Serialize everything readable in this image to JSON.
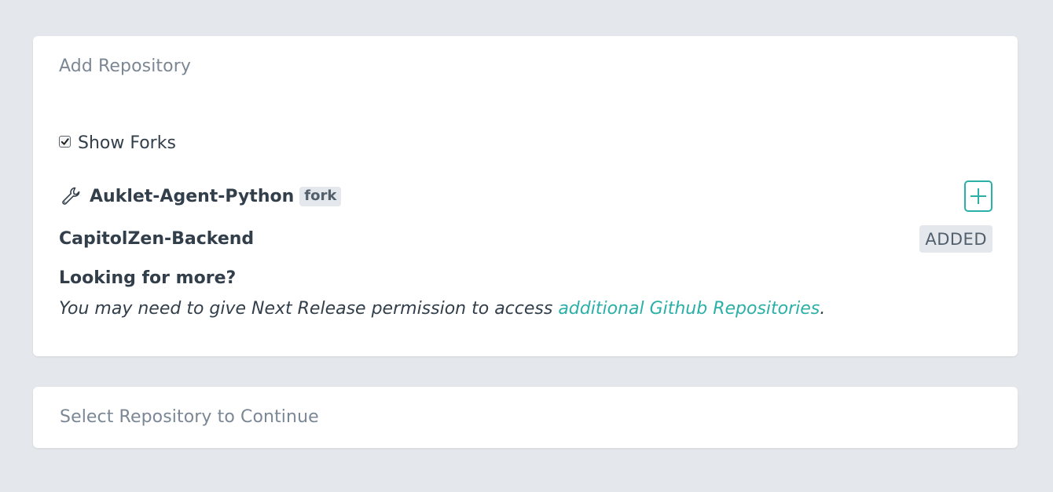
{
  "add_repository": {
    "title": "Add Repository",
    "show_forks": {
      "label": "Show Forks",
      "checked": true
    },
    "repositories": [
      {
        "name": "Auklet-Agent-Python",
        "badge": "fork",
        "icon": "wrench-icon",
        "action": "add"
      },
      {
        "name": "CapitolZen-Backend",
        "status": "ADDED"
      }
    ],
    "more": {
      "heading": "Looking for more?",
      "text_before": "You may need to give Next Release permission to access ",
      "link_text": "additional Github Repositories",
      "text_after": "."
    }
  },
  "select_repository": {
    "title": "Select Repository to Continue"
  },
  "colors": {
    "background": "#e4e7eb",
    "accent": "#2bb0a8",
    "text": "#323f4b",
    "muted": "#7b8794"
  }
}
